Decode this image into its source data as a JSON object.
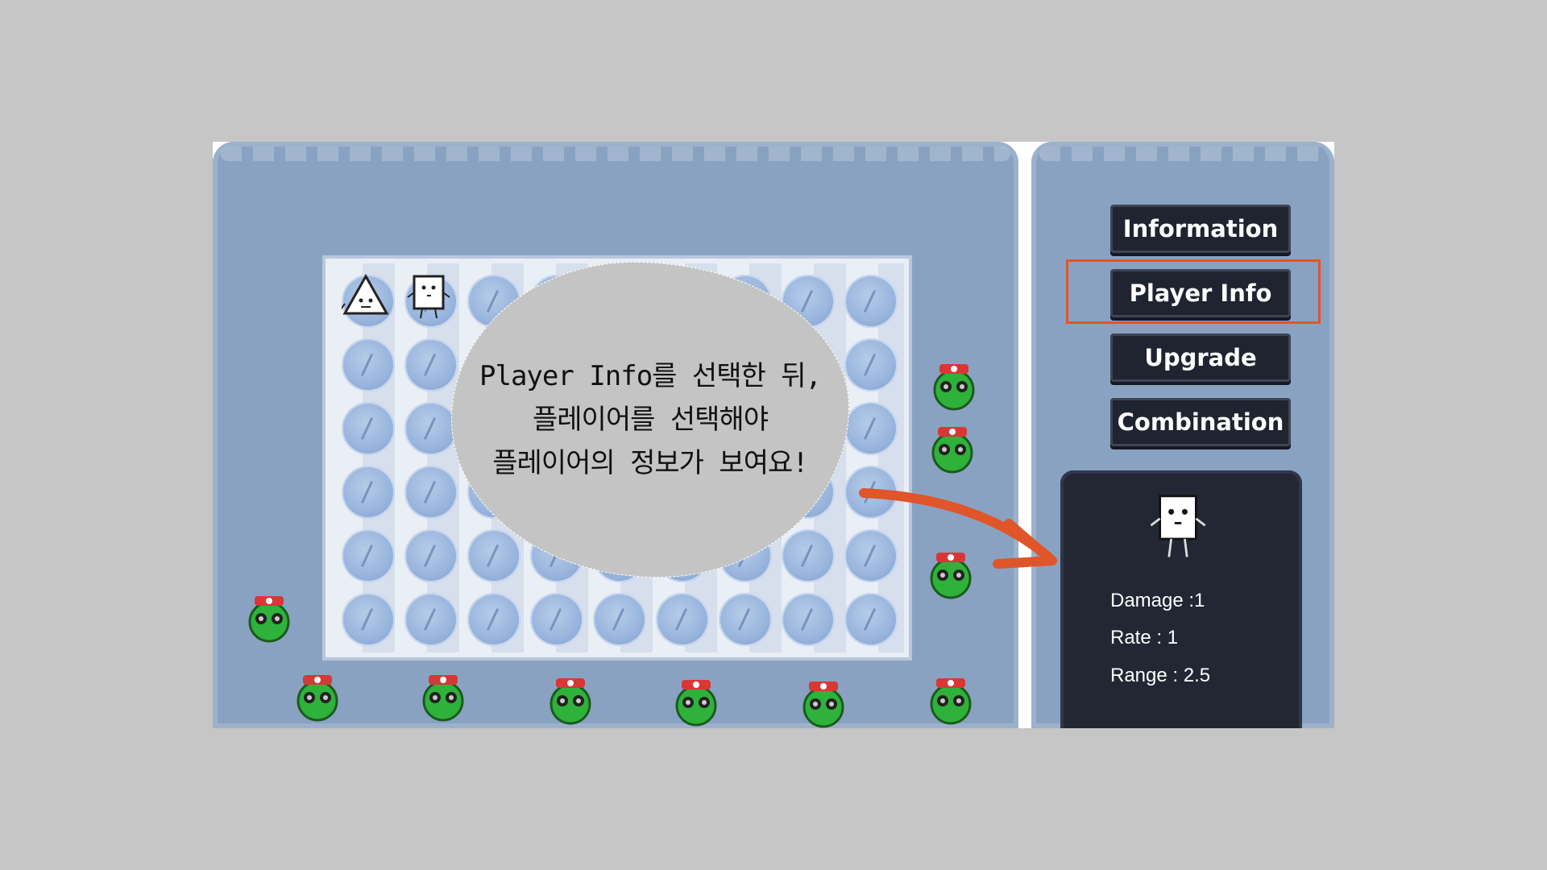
{
  "tip": {
    "text": "Player Info를 선택한 뒤,\n플레이어를 선택해야\n플레이어의 정보가 보여요!"
  },
  "menu": {
    "information_label": "Information",
    "player_info_label": "Player Info",
    "upgrade_label": "Upgrade",
    "combination_label": "Combination"
  },
  "player_info": {
    "damage": "Damage :1",
    "rate": "Rate : 1",
    "range": "Range : 2.5"
  },
  "colors": {
    "highlight": "#e0552a",
    "arrow": "#e0552a",
    "field": "#8aa2c1",
    "button": "#1f2430"
  },
  "icons": [
    "triangle-player-icon",
    "square-player-icon",
    "green-enemy-icon",
    "arrow-icon"
  ]
}
